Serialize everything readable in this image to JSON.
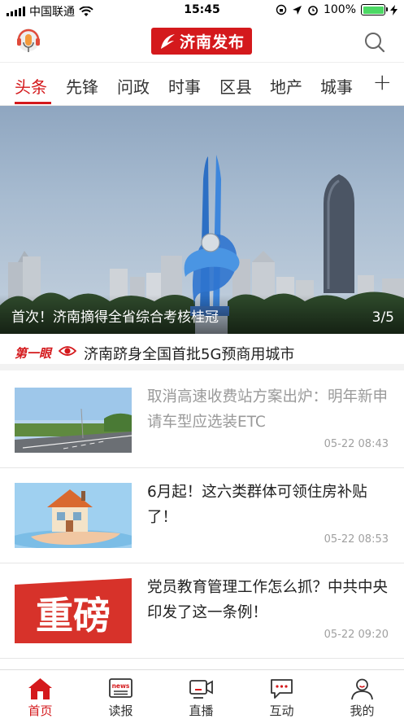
{
  "status_bar": {
    "carrier": "中国联通",
    "time": "15:45",
    "battery": "100%",
    "battery_level": 1.0
  },
  "header": {
    "logo_text": "济南发布",
    "icons": [
      "microphone-icon",
      "search-icon"
    ]
  },
  "tabs": {
    "items": [
      "头条",
      "先锋",
      "问政",
      "时事",
      "区县",
      "地产",
      "城事"
    ],
    "active": "头条",
    "add_label": "+"
  },
  "banner": {
    "title": "首次！济南摘得全省综合考核桂冠",
    "index": "3/5"
  },
  "first_look": {
    "tag": "第一眼",
    "text": "济南跻身全国首批5G预商用城市"
  },
  "news": [
    {
      "title": "取消高速收费站方案出炉：明年新申请车型应选装ETC",
      "time": "05-22 08:43",
      "read": true
    },
    {
      "title": "6月起！这六类群体可领住房补贴了！",
      "time": "05-22 08:53",
      "read": false
    },
    {
      "title": "党员教育管理工作怎么抓？中共中央印发了这一条例！",
      "time": "05-22 09:20",
      "read": false,
      "thumb_text": "重磅"
    }
  ],
  "bottom_nav": {
    "items": [
      {
        "label": "首页",
        "icon": "home-icon"
      },
      {
        "label": "读报",
        "icon": "news-icon",
        "badge": "news"
      },
      {
        "label": "直播",
        "icon": "live-icon"
      },
      {
        "label": "互动",
        "icon": "chat-icon"
      },
      {
        "label": "我的",
        "icon": "user-icon"
      }
    ],
    "active": "首页"
  },
  "colors": {
    "accent": "#d4191c",
    "text": "#222222",
    "read_text": "#9a9a9a",
    "time": "#a0a0a0"
  }
}
